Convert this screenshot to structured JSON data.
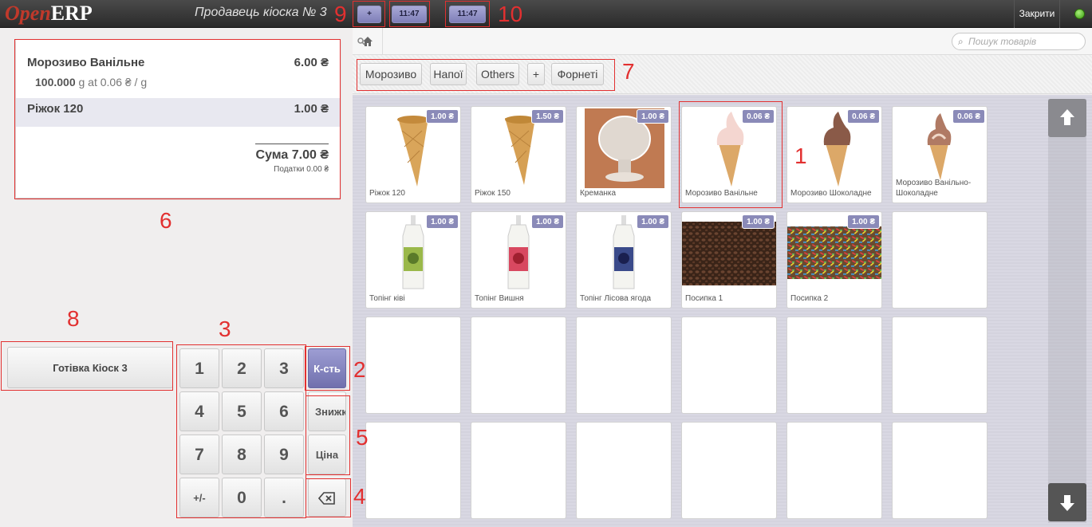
{
  "header": {
    "logo_open": "Open",
    "logo_erp": "ERP",
    "cashier": "Продавець кіоска № 3",
    "add_order": "+",
    "order_tab_1": "11:47",
    "order_tab_2": "11:47",
    "close": "Закрити"
  },
  "order": {
    "lines": [
      {
        "name": "Морозиво Ванільне",
        "price": "6.00 ₴",
        "qty": "100.000",
        "unit_detail": "g at 0.06 ₴ / g"
      },
      {
        "name": "Ріжок 120",
        "price": "1.00 ₴"
      }
    ],
    "total": "Сума 7.00 ₴",
    "taxes": "Податки 0.00 ₴"
  },
  "payment": {
    "cash_label": "Готівка Кіоск 3"
  },
  "numpad": {
    "keys": [
      "1",
      "2",
      "3",
      "4",
      "5",
      "6",
      "7",
      "8",
      "9",
      "+/-",
      "0",
      "."
    ],
    "mode_qty": "К-сть",
    "mode_disc": "Знижка",
    "mode_price": "Ціна"
  },
  "search": {
    "placeholder": "Пошук товарів"
  },
  "categories": [
    "Морозиво",
    "Напої",
    "Others",
    "+",
    "Форнеті"
  ],
  "products": [
    {
      "name": "Ріжок 120",
      "price": "1.00 ₴",
      "icon": "waffle-cone"
    },
    {
      "name": "Ріжок 150",
      "price": "1.50 ₴",
      "icon": "waffle-cone"
    },
    {
      "name": "Креманка",
      "price": "1.00 ₴",
      "icon": "glass-bowl"
    },
    {
      "name": "Морозиво Ванільне",
      "price": "0.06 ₴",
      "icon": "vanilla-cone"
    },
    {
      "name": "Морозиво Шоколадне",
      "price": "0.06 ₴",
      "icon": "chocolate-cone"
    },
    {
      "name": "Морозиво Ванільно-Шоколадне",
      "price": "0.06 ₴",
      "icon": "mixed-cone"
    },
    {
      "name": "Топінг ківі",
      "price": "1.00 ₴",
      "icon": "topping-bottle"
    },
    {
      "name": "Топінг Вишня",
      "price": "1.00 ₴",
      "icon": "topping-bottle"
    },
    {
      "name": "Топінг Лісова ягода",
      "price": "1.00 ₴",
      "icon": "topping-bottle"
    },
    {
      "name": "Посипка 1",
      "price": "1.00 ₴",
      "icon": "chocolate-sprinkles"
    },
    {
      "name": "Посипка 2",
      "price": "1.00 ₴",
      "icon": "color-sprinkles"
    }
  ],
  "annotations": [
    "1",
    "2",
    "3",
    "4",
    "5",
    "6",
    "7",
    "8",
    "9",
    "10"
  ],
  "colors": {
    "accent": "#8a8ab8",
    "annotation": "#e23030",
    "logo_red": "#c0392b"
  }
}
